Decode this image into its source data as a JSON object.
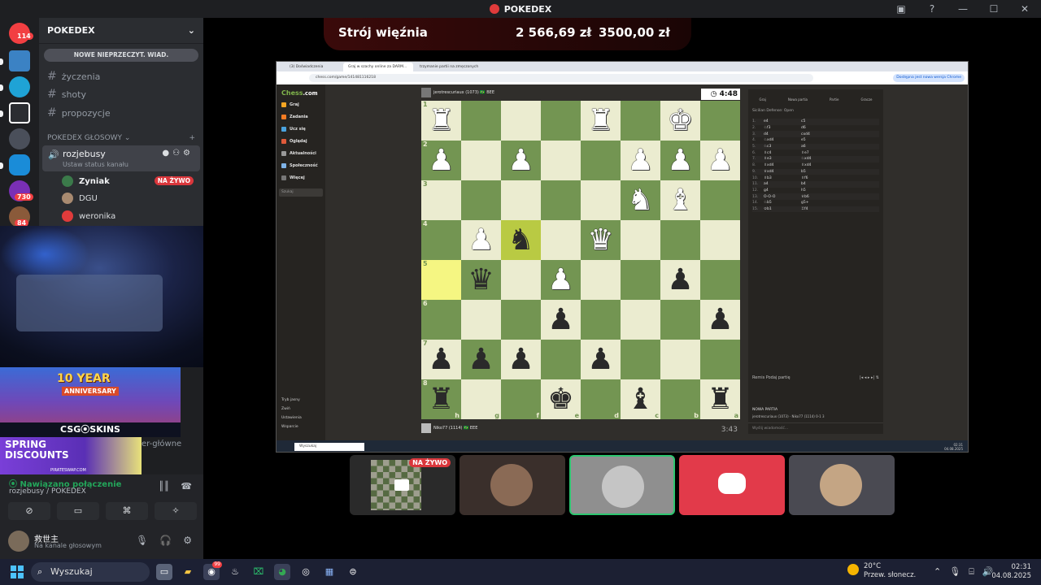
{
  "window": {
    "app_title": "POKEDEX"
  },
  "rail": {
    "badges": [
      "114",
      "730",
      "84"
    ]
  },
  "sidebar": {
    "server_name": "POKEDEX",
    "new_messages": "NOWE NIEPRZECZYT. WIAD.",
    "text_channels": [
      "życzenia",
      "shoty",
      "propozycje"
    ],
    "voice_category": "POKEDEX GŁOSOWY",
    "voice_channel": {
      "name": "rozjebusy",
      "status": "Ustaw status kanału"
    },
    "voice_users": [
      {
        "name": "Zyniak",
        "live": "NA ŻYWO"
      },
      {
        "name": "DGU"
      },
      {
        "name": "weronika"
      }
    ],
    "partial_channel": "er-główne"
  },
  "ads": {
    "ad1_title": "10 YEAR",
    "ad1_sub": "ANNIVERSARY",
    "ad1_brand": "CSG⦿SKINS",
    "ad2_line1": "SPRING",
    "ad2_line2": "DISCOUNTS",
    "ad2_brand": "PIRATESWAP.COM"
  },
  "voice_panel": {
    "status": "Nawiązano połączenie",
    "location": "rozjebusy / POKEDEX"
  },
  "user": {
    "name": "救世主",
    "status": "Na kanale głosowym"
  },
  "goal": {
    "name": "Strój więźnia",
    "current": "2 566,69 zł",
    "separator": "z",
    "target": "3500,00 zł"
  },
  "browser": {
    "tabs": [
      "(3) Doświadczenia",
      "Graj w szachy online za DARM...",
      "trzymanie partii na zmęczonych"
    ],
    "url": "chess.com/game/141481116218",
    "update_label": "Dostępna jest nowa wersja Chrome"
  },
  "chesscom": {
    "logo_main": "Chess",
    "logo_tld": ".com",
    "nav": [
      "Graj",
      "Zadania",
      "Ucz się",
      "Oglądaj",
      "Aktualności",
      "Społeczność",
      "Więcej"
    ],
    "search_placeholder": "Szukaj",
    "bottom": [
      "Tryb jasny",
      "Zwiń",
      "Ustawienia",
      "Wsparcie"
    ],
    "top_player": "jerotrescuriaux (1073) 🇧🇷 BEE",
    "top_clock": "4:48",
    "bottom_player": "Niko77 (1114) 🇧🇷 EEE",
    "bottom_clock": "3:43",
    "files": [
      "h",
      "g",
      "f",
      "e",
      "d",
      "c",
      "b",
      "a"
    ],
    "ranks": [
      "1",
      "2",
      "3",
      "4",
      "5",
      "6",
      "7",
      "8"
    ],
    "board": [
      [
        "wR",
        "",
        "",
        "",
        "wR",
        "",
        "wK",
        ""
      ],
      [
        "wP",
        "",
        "wP",
        "",
        "",
        "wP",
        "wP",
        "wP"
      ],
      [
        "",
        "",
        "",
        "",
        "",
        "wN",
        "wB",
        ""
      ],
      [
        "",
        "wP",
        "bN",
        "",
        "wQ",
        "",
        "",
        ""
      ],
      [
        "",
        "bQ",
        "",
        "wP",
        "",
        "",
        "bP",
        ""
      ],
      [
        "",
        "",
        "",
        "bP",
        "",
        "",
        "",
        "bP"
      ],
      [
        "bP",
        "bP",
        "bP",
        "",
        "bP",
        "",
        "",
        ""
      ],
      [
        "bR",
        "",
        "",
        "bK",
        "",
        "bB",
        "",
        "bR"
      ]
    ],
    "highlight": [
      [
        3,
        2
      ],
      [
        4,
        0
      ]
    ],
    "tabs": [
      "Graj",
      "Nowa partia",
      "Partie",
      "Gracze"
    ],
    "opening": "Sicilian Defense: Open",
    "moves": [
      [
        "1.",
        "e4",
        "c5"
      ],
      [
        "2.",
        "♘f3",
        "d6"
      ],
      [
        "3.",
        "d4",
        "cxd4"
      ],
      [
        "4.",
        "♘xd4",
        "e5"
      ],
      [
        "5.",
        "♘c3",
        "a6"
      ],
      [
        "6.",
        "♗c4",
        "♗e7"
      ],
      [
        "7.",
        "♗e3",
        "♘xd4"
      ],
      [
        "8.",
        "♗xd4",
        "♗xd4"
      ],
      [
        "9.",
        "♕xd4",
        "b5"
      ],
      [
        "10.",
        "♗b3",
        "♗f6"
      ],
      [
        "11.",
        "a4",
        "b4"
      ],
      [
        "12.",
        "g4",
        "h5"
      ],
      [
        "13.",
        "O-O-O",
        "♕b6"
      ],
      [
        "14.",
        "♘b5",
        "g5+"
      ],
      [
        "15.",
        "♔b1",
        "♖f4"
      ]
    ],
    "nav_labels": "Remis  Podaj partię",
    "new_game": "NOWA PARTIA",
    "result": "jerotrescuriaux (1073) · Niko77 (1114) 0-1 3",
    "chat_placeholder": "Wyślij wiadomość..."
  },
  "taskbar_inner": {
    "search": "Wyszukaj",
    "time": "02:31",
    "date": "04.08.2025"
  },
  "participants": {
    "live": "NA ŻYWO"
  },
  "taskbar": {
    "search": "Wyszukaj",
    "weather_temp": "20°C",
    "weather_desc": "Przew. słonecz.",
    "time": "02:31",
    "date": "04.08.2025",
    "discord_badge": "99"
  }
}
